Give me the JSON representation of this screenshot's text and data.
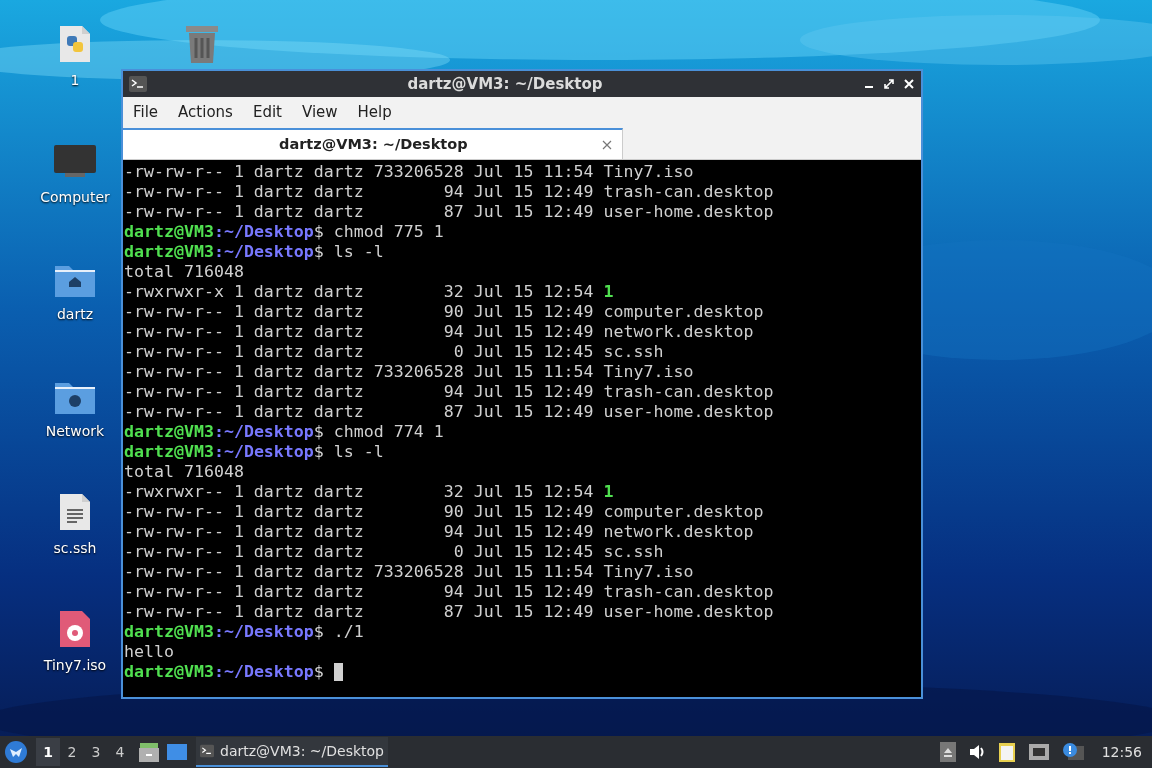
{
  "desktop_icons": [
    {
      "label": "1",
      "kind": "python"
    },
    {
      "label": "Computer",
      "kind": "computer"
    },
    {
      "label": "dartz",
      "kind": "home"
    },
    {
      "label": "Network",
      "kind": "network"
    },
    {
      "label": "sc.ssh",
      "kind": "text"
    },
    {
      "label": "Tiny7.iso",
      "kind": "disc"
    }
  ],
  "window": {
    "title": "dartz@VM3: ~/Desktop"
  },
  "menu": [
    "File",
    "Actions",
    "Edit",
    "View",
    "Help"
  ],
  "tabs": [
    {
      "label": "dartz@VM3: ~/Desktop",
      "selected": true
    }
  ],
  "terminal_lines": [
    {
      "kind": "listing",
      "meta": "-rw-rw-r-- 1 dartz dartz 733206528 Jul 15 11:54 ",
      "name": "Tiny7.iso",
      "executable": false
    },
    {
      "kind": "listing",
      "meta": "-rw-rw-r-- 1 dartz dartz        94 Jul 15 12:49 ",
      "name": "trash-can.desktop",
      "executable": false
    },
    {
      "kind": "listing",
      "meta": "-rw-rw-r-- 1 dartz dartz        87 Jul 15 12:49 ",
      "name": "user-home.desktop",
      "executable": false
    },
    {
      "kind": "prompt",
      "user": "dartz@VM3",
      "path": ":~/Desktop",
      "command": "$ chmod 775 1",
      "cursor": false
    },
    {
      "kind": "prompt",
      "user": "dartz@VM3",
      "path": ":~/Desktop",
      "command": "$ ls -l",
      "cursor": false
    },
    {
      "kind": "text",
      "text": "total 716048"
    },
    {
      "kind": "listing",
      "meta": "-rwxrwxr-x 1 dartz dartz        32 Jul 15 12:54 ",
      "name": "1",
      "executable": true
    },
    {
      "kind": "listing",
      "meta": "-rw-rw-r-- 1 dartz dartz        90 Jul 15 12:49 ",
      "name": "computer.desktop",
      "executable": false
    },
    {
      "kind": "listing",
      "meta": "-rw-rw-r-- 1 dartz dartz        94 Jul 15 12:49 ",
      "name": "network.desktop",
      "executable": false
    },
    {
      "kind": "listing",
      "meta": "-rw-rw-r-- 1 dartz dartz         0 Jul 15 12:45 ",
      "name": "sc.ssh",
      "executable": false
    },
    {
      "kind": "listing",
      "meta": "-rw-rw-r-- 1 dartz dartz 733206528 Jul 15 11:54 ",
      "name": "Tiny7.iso",
      "executable": false
    },
    {
      "kind": "listing",
      "meta": "-rw-rw-r-- 1 dartz dartz        94 Jul 15 12:49 ",
      "name": "trash-can.desktop",
      "executable": false
    },
    {
      "kind": "listing",
      "meta": "-rw-rw-r-- 1 dartz dartz        87 Jul 15 12:49 ",
      "name": "user-home.desktop",
      "executable": false
    },
    {
      "kind": "prompt",
      "user": "dartz@VM3",
      "path": ":~/Desktop",
      "command": "$ chmod 774 1",
      "cursor": false
    },
    {
      "kind": "prompt",
      "user": "dartz@VM3",
      "path": ":~/Desktop",
      "command": "$ ls -l",
      "cursor": false
    },
    {
      "kind": "text",
      "text": "total 716048"
    },
    {
      "kind": "listing",
      "meta": "-rwxrwxr-- 1 dartz dartz        32 Jul 15 12:54 ",
      "name": "1",
      "executable": true
    },
    {
      "kind": "listing",
      "meta": "-rw-rw-r-- 1 dartz dartz        90 Jul 15 12:49 ",
      "name": "computer.desktop",
      "executable": false
    },
    {
      "kind": "listing",
      "meta": "-rw-rw-r-- 1 dartz dartz        94 Jul 15 12:49 ",
      "name": "network.desktop",
      "executable": false
    },
    {
      "kind": "listing",
      "meta": "-rw-rw-r-- 1 dartz dartz         0 Jul 15 12:45 ",
      "name": "sc.ssh",
      "executable": false
    },
    {
      "kind": "listing",
      "meta": "-rw-rw-r-- 1 dartz dartz 733206528 Jul 15 11:54 ",
      "name": "Tiny7.iso",
      "executable": false
    },
    {
      "kind": "listing",
      "meta": "-rw-rw-r-- 1 dartz dartz        94 Jul 15 12:49 ",
      "name": "trash-can.desktop",
      "executable": false
    },
    {
      "kind": "listing",
      "meta": "-rw-rw-r-- 1 dartz dartz        87 Jul 15 12:49 ",
      "name": "user-home.desktop",
      "executable": false
    },
    {
      "kind": "prompt",
      "user": "dartz@VM3",
      "path": ":~/Desktop",
      "command": "$ ./1",
      "cursor": false
    },
    {
      "kind": "text",
      "text": "hello"
    },
    {
      "kind": "prompt",
      "user": "dartz@VM3",
      "path": ":~/Desktop",
      "command": "$ ",
      "cursor": true
    }
  ],
  "taskbar": {
    "workspaces": [
      {
        "label": "1",
        "selected": true
      },
      {
        "label": "2",
        "selected": false
      },
      {
        "label": "3",
        "selected": false
      },
      {
        "label": "4",
        "selected": false
      }
    ],
    "task": {
      "label": "dartz@VM3: ~/Desktop",
      "selected": true
    },
    "clock": "12:56"
  }
}
